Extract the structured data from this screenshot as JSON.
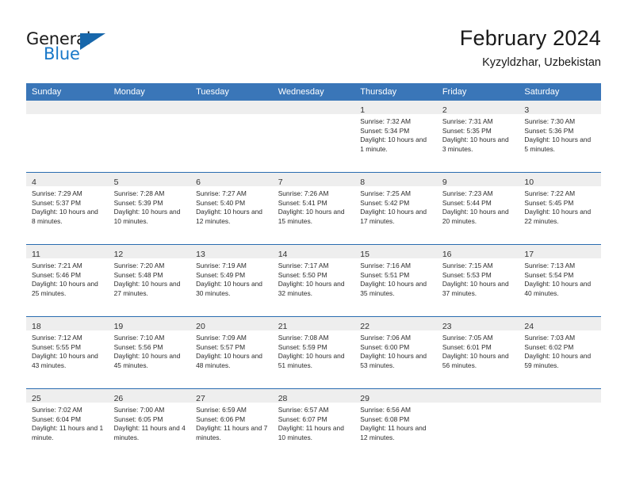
{
  "brand": {
    "name_part1": "General",
    "name_part2": "Blue",
    "logo_icon": "triangle-flag-icon"
  },
  "header": {
    "title": "February 2024",
    "subtitle": "Kyzyldzhar, Uzbekistan"
  },
  "colors": {
    "header_blue": "#3a76b8",
    "row_separator_blue": "#2a6cb0",
    "day_band_gray": "#eeeeee",
    "brand_blue": "#1878c8",
    "text_dark": "#1a1a1a"
  },
  "weekday_headers": [
    "Sunday",
    "Monday",
    "Tuesday",
    "Wednesday",
    "Thursday",
    "Friday",
    "Saturday"
  ],
  "weeks": [
    [
      {
        "day": "",
        "empty": true
      },
      {
        "day": "",
        "empty": true
      },
      {
        "day": "",
        "empty": true
      },
      {
        "day": "",
        "empty": true
      },
      {
        "day": "1",
        "sunrise": "Sunrise: 7:32 AM",
        "sunset": "Sunset: 5:34 PM",
        "daylight": "Daylight: 10 hours and 1 minute."
      },
      {
        "day": "2",
        "sunrise": "Sunrise: 7:31 AM",
        "sunset": "Sunset: 5:35 PM",
        "daylight": "Daylight: 10 hours and 3 minutes."
      },
      {
        "day": "3",
        "sunrise": "Sunrise: 7:30 AM",
        "sunset": "Sunset: 5:36 PM",
        "daylight": "Daylight: 10 hours and 5 minutes."
      }
    ],
    [
      {
        "day": "4",
        "sunrise": "Sunrise: 7:29 AM",
        "sunset": "Sunset: 5:37 PM",
        "daylight": "Daylight: 10 hours and 8 minutes."
      },
      {
        "day": "5",
        "sunrise": "Sunrise: 7:28 AM",
        "sunset": "Sunset: 5:39 PM",
        "daylight": "Daylight: 10 hours and 10 minutes."
      },
      {
        "day": "6",
        "sunrise": "Sunrise: 7:27 AM",
        "sunset": "Sunset: 5:40 PM",
        "daylight": "Daylight: 10 hours and 12 minutes."
      },
      {
        "day": "7",
        "sunrise": "Sunrise: 7:26 AM",
        "sunset": "Sunset: 5:41 PM",
        "daylight": "Daylight: 10 hours and 15 minutes."
      },
      {
        "day": "8",
        "sunrise": "Sunrise: 7:25 AM",
        "sunset": "Sunset: 5:42 PM",
        "daylight": "Daylight: 10 hours and 17 minutes."
      },
      {
        "day": "9",
        "sunrise": "Sunrise: 7:23 AM",
        "sunset": "Sunset: 5:44 PM",
        "daylight": "Daylight: 10 hours and 20 minutes."
      },
      {
        "day": "10",
        "sunrise": "Sunrise: 7:22 AM",
        "sunset": "Sunset: 5:45 PM",
        "daylight": "Daylight: 10 hours and 22 minutes."
      }
    ],
    [
      {
        "day": "11",
        "sunrise": "Sunrise: 7:21 AM",
        "sunset": "Sunset: 5:46 PM",
        "daylight": "Daylight: 10 hours and 25 minutes."
      },
      {
        "day": "12",
        "sunrise": "Sunrise: 7:20 AM",
        "sunset": "Sunset: 5:48 PM",
        "daylight": "Daylight: 10 hours and 27 minutes."
      },
      {
        "day": "13",
        "sunrise": "Sunrise: 7:19 AM",
        "sunset": "Sunset: 5:49 PM",
        "daylight": "Daylight: 10 hours and 30 minutes."
      },
      {
        "day": "14",
        "sunrise": "Sunrise: 7:17 AM",
        "sunset": "Sunset: 5:50 PM",
        "daylight": "Daylight: 10 hours and 32 minutes."
      },
      {
        "day": "15",
        "sunrise": "Sunrise: 7:16 AM",
        "sunset": "Sunset: 5:51 PM",
        "daylight": "Daylight: 10 hours and 35 minutes."
      },
      {
        "day": "16",
        "sunrise": "Sunrise: 7:15 AM",
        "sunset": "Sunset: 5:53 PM",
        "daylight": "Daylight: 10 hours and 37 minutes."
      },
      {
        "day": "17",
        "sunrise": "Sunrise: 7:13 AM",
        "sunset": "Sunset: 5:54 PM",
        "daylight": "Daylight: 10 hours and 40 minutes."
      }
    ],
    [
      {
        "day": "18",
        "sunrise": "Sunrise: 7:12 AM",
        "sunset": "Sunset: 5:55 PM",
        "daylight": "Daylight: 10 hours and 43 minutes."
      },
      {
        "day": "19",
        "sunrise": "Sunrise: 7:10 AM",
        "sunset": "Sunset: 5:56 PM",
        "daylight": "Daylight: 10 hours and 45 minutes."
      },
      {
        "day": "20",
        "sunrise": "Sunrise: 7:09 AM",
        "sunset": "Sunset: 5:57 PM",
        "daylight": "Daylight: 10 hours and 48 minutes."
      },
      {
        "day": "21",
        "sunrise": "Sunrise: 7:08 AM",
        "sunset": "Sunset: 5:59 PM",
        "daylight": "Daylight: 10 hours and 51 minutes."
      },
      {
        "day": "22",
        "sunrise": "Sunrise: 7:06 AM",
        "sunset": "Sunset: 6:00 PM",
        "daylight": "Daylight: 10 hours and 53 minutes."
      },
      {
        "day": "23",
        "sunrise": "Sunrise: 7:05 AM",
        "sunset": "Sunset: 6:01 PM",
        "daylight": "Daylight: 10 hours and 56 minutes."
      },
      {
        "day": "24",
        "sunrise": "Sunrise: 7:03 AM",
        "sunset": "Sunset: 6:02 PM",
        "daylight": "Daylight: 10 hours and 59 minutes."
      }
    ],
    [
      {
        "day": "25",
        "sunrise": "Sunrise: 7:02 AM",
        "sunset": "Sunset: 6:04 PM",
        "daylight": "Daylight: 11 hours and 1 minute."
      },
      {
        "day": "26",
        "sunrise": "Sunrise: 7:00 AM",
        "sunset": "Sunset: 6:05 PM",
        "daylight": "Daylight: 11 hours and 4 minutes."
      },
      {
        "day": "27",
        "sunrise": "Sunrise: 6:59 AM",
        "sunset": "Sunset: 6:06 PM",
        "daylight": "Daylight: 11 hours and 7 minutes."
      },
      {
        "day": "28",
        "sunrise": "Sunrise: 6:57 AM",
        "sunset": "Sunset: 6:07 PM",
        "daylight": "Daylight: 11 hours and 10 minutes."
      },
      {
        "day": "29",
        "sunrise": "Sunrise: 6:56 AM",
        "sunset": "Sunset: 6:08 PM",
        "daylight": "Daylight: 11 hours and 12 minutes."
      },
      {
        "day": "",
        "empty": true
      },
      {
        "day": "",
        "empty": true
      }
    ]
  ]
}
